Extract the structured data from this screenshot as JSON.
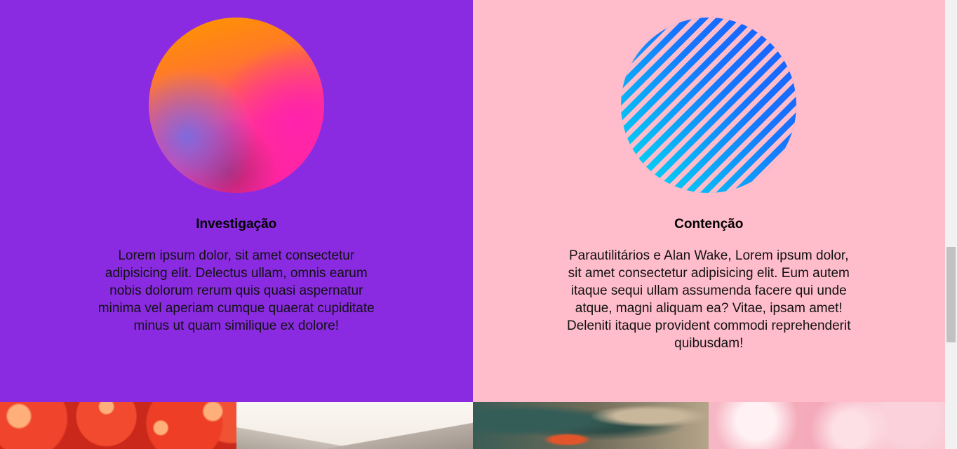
{
  "features": [
    {
      "title": "Investigação",
      "text": "Lorem ipsum dolor, sit amet consectetur adipisicing elit. Delectus ullam, omnis earum nobis dolorum rerum quis quasi aspernatur minima vel aperiam cumque quaerat cupiditate minus ut quam similique ex dolore!",
      "background": "#8a2be2",
      "icon": "gradient-sphere-icon"
    },
    {
      "title": "Contenção",
      "text": "Parautilitários e Alan Wake, Lorem ipsum dolor, sit amet consectetur adipisicing elit. Eum autem itaque sequi ullam assumenda facere qui unde atque, magni aliquam ea? Vitae, ipsam amet! Deleniti itaque provident commodi reprehenderit quibusdam!",
      "background": "#ffbccb",
      "icon": "striped-sphere-icon"
    }
  ],
  "gallery": {
    "images": [
      "tomatoes-photo",
      "mountains-photo",
      "leaves-flower-photo",
      "pink-blossom-photo"
    ]
  },
  "scrollbar": {
    "position": 0.55
  }
}
